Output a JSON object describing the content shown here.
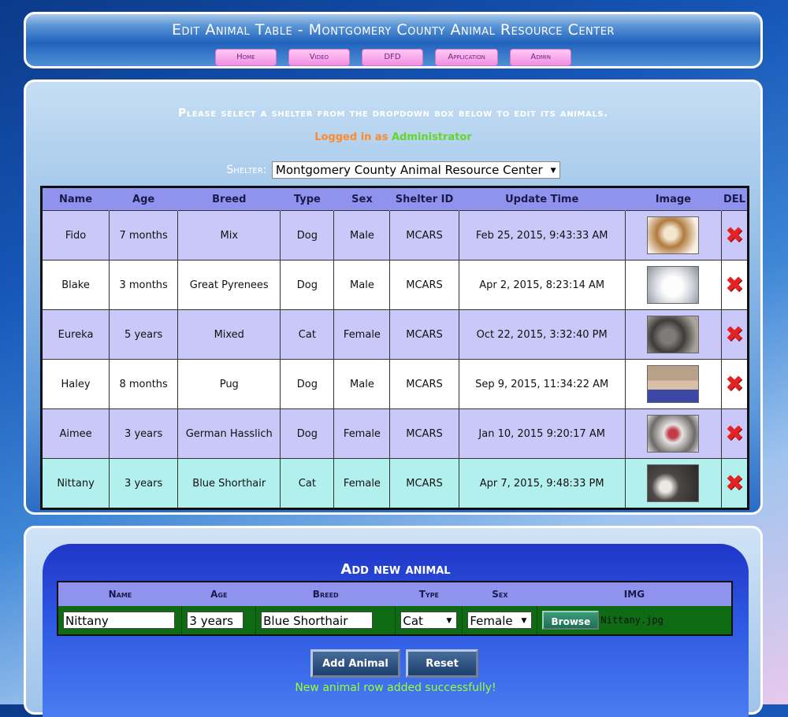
{
  "header": {
    "title": "Edit Animal Table - Montgomery County Animal Resource Center",
    "nav": [
      "Home",
      "Video",
      "DFD",
      "Application",
      "Admin"
    ]
  },
  "main": {
    "prompt": "Please select a shelter from the dropdown box below to edit its animals.",
    "login_label": "Logged in as",
    "login_user": "Administrator",
    "shelter_label": "Shelter:",
    "shelter_value": "Montgomery County Animal Resource Center"
  },
  "table": {
    "headers": [
      "Name",
      "Age",
      "Breed",
      "Type",
      "Sex",
      "Shelter ID",
      "Update Time",
      "Image",
      "DEL"
    ],
    "rows": [
      {
        "name": "Fido",
        "age": "7 months",
        "breed": "Mix",
        "type": "Dog",
        "sex": "Male",
        "shelter": "MCARS",
        "updated": "Feb 25, 2015, 9:43:33 AM"
      },
      {
        "name": "Blake",
        "age": "3 months",
        "breed": "Great Pyrenees",
        "type": "Dog",
        "sex": "Male",
        "shelter": "MCARS",
        "updated": "Apr 2, 2015, 8:23:14 AM"
      },
      {
        "name": "Eureka",
        "age": "5 years",
        "breed": "Mixed",
        "type": "Cat",
        "sex": "Female",
        "shelter": "MCARS",
        "updated": "Oct 22, 2015, 3:32:40 PM"
      },
      {
        "name": "Haley",
        "age": "8 months",
        "breed": "Pug",
        "type": "Dog",
        "sex": "Male",
        "shelter": "MCARS",
        "updated": "Sep 9, 2015, 11:34:22 AM"
      },
      {
        "name": "Aimee",
        "age": "3 years",
        "breed": "German Hasslich",
        "type": "Dog",
        "sex": "Female",
        "shelter": "MCARS",
        "updated": "Jan 10, 2015 9:20:17 AM"
      },
      {
        "name": "Nittany",
        "age": "3 years",
        "breed": "Blue Shorthair",
        "type": "Cat",
        "sex": "Female",
        "shelter": "MCARS",
        "updated": "Apr 7, 2015, 9:48:33 PM"
      }
    ]
  },
  "add": {
    "title": "Add new animal",
    "headers": [
      "Name",
      "Age",
      "Breed",
      "Type",
      "Sex",
      "IMG"
    ],
    "name": "Nittany",
    "age": "3 years",
    "breed": "Blue Shorthair",
    "type": "Cat",
    "sex": "Female",
    "browse_label": "Browse",
    "file_name": "Nittany.jpg",
    "add_label": "Add Animal",
    "reset_label": "Reset",
    "message": "New animal row added successfully!"
  }
}
